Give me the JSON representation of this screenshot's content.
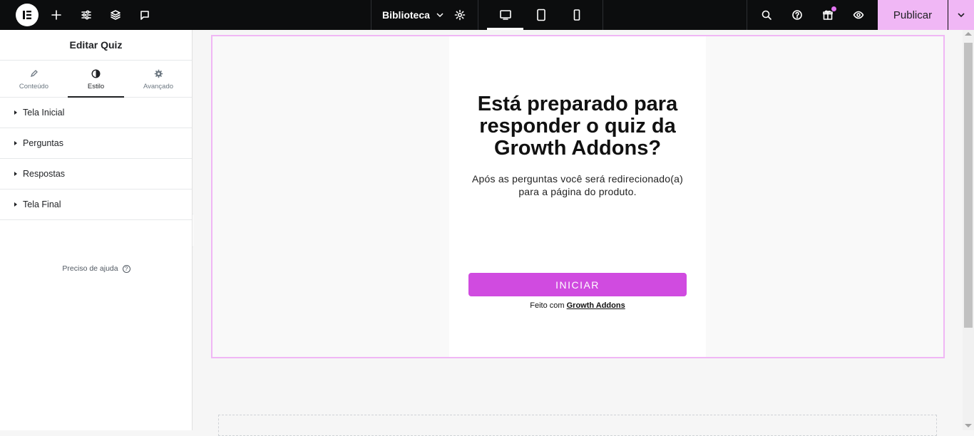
{
  "topbar": {
    "library_label": "Biblioteca",
    "publish_label": "Publicar",
    "accent_color": "#f0b7f5",
    "icons": [
      "elementor-logo-icon",
      "plus-icon",
      "sliders-icon",
      "layers-icon",
      "comment-icon",
      "chevron-down-icon",
      "gear-icon",
      "desktop-icon",
      "tablet-icon",
      "mobile-icon",
      "search-icon",
      "help-icon",
      "gift-icon",
      "eye-icon",
      "chevron-down-icon"
    ]
  },
  "panel": {
    "title": "Editar Quiz",
    "tabs": [
      {
        "label": "Conteúdo",
        "icon": "pencil-icon"
      },
      {
        "label": "Estilo",
        "icon": "contrast-icon",
        "active": true
      },
      {
        "label": "Avançado",
        "icon": "gear-icon"
      }
    ],
    "sections": [
      {
        "label": "Tela Inicial"
      },
      {
        "label": "Perguntas"
      },
      {
        "label": "Respostas"
      },
      {
        "label": "Tela Final"
      }
    ],
    "help_label": "Preciso de ajuda"
  },
  "quiz": {
    "headline": "Está preparado para responder o quiz da Growth Addons?",
    "subtitle": "Após as perguntas você será redirecionado(a) para a página do produto.",
    "start_button": "INICIAR",
    "button_color": "#d04be0",
    "made_with_prefix": "Feito com",
    "made_with_link": "Growth Addons"
  }
}
